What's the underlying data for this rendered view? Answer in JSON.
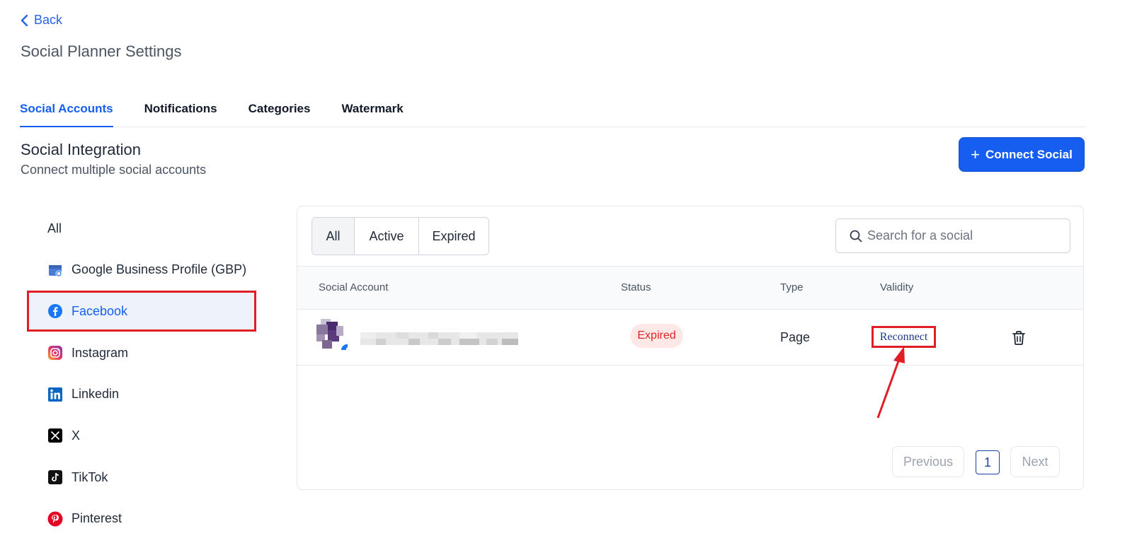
{
  "header": {
    "back_label": "Back",
    "title": "Social Planner Settings"
  },
  "tabs": [
    {
      "label": "Social Accounts",
      "active": true
    },
    {
      "label": "Notifications",
      "active": false
    },
    {
      "label": "Categories",
      "active": false
    },
    {
      "label": "Watermark",
      "active": false
    }
  ],
  "section": {
    "title": "Social Integration",
    "subtitle": "Connect multiple social accounts",
    "connect_label": "Connect Social"
  },
  "sidebar": {
    "items": [
      {
        "label": "All",
        "icon": "none"
      },
      {
        "label": "Google Business Profile (GBP)",
        "icon": "gbp-icon"
      },
      {
        "label": "Facebook",
        "icon": "facebook-icon",
        "selected": true
      },
      {
        "label": "Instagram",
        "icon": "instagram-icon"
      },
      {
        "label": "Linkedin",
        "icon": "linkedin-icon"
      },
      {
        "label": "X",
        "icon": "x-icon"
      },
      {
        "label": "TikTok",
        "icon": "tiktok-icon"
      },
      {
        "label": "Pinterest",
        "icon": "pinterest-icon"
      }
    ]
  },
  "filters": [
    {
      "label": "All",
      "active": true
    },
    {
      "label": "Active",
      "active": false
    },
    {
      "label": "Expired",
      "active": false
    }
  ],
  "search": {
    "placeholder": "Search for a social"
  },
  "table": {
    "columns": [
      "Social Account",
      "Status",
      "Type",
      "Validity"
    ],
    "rows": [
      {
        "account": "",
        "status": "Expired",
        "type": "Page",
        "validity": "Reconnect"
      }
    ]
  },
  "pagination": {
    "previous": "Previous",
    "page": "1",
    "next": "Next"
  },
  "colors": {
    "accent": "#155eef",
    "highlight": "#e11d26",
    "expired_bg": "#fde8e8",
    "expired_text": "#dc2626"
  }
}
